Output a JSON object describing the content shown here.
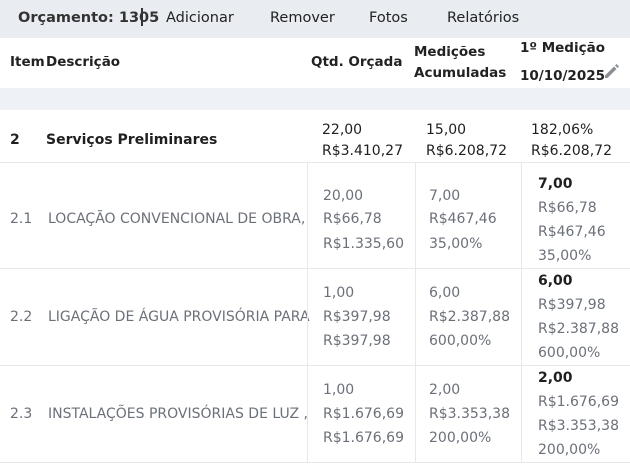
{
  "toolbar": {
    "budget_label": "Orçamento: 1305",
    "add_label": "Adicionar",
    "remove_label": "Remover",
    "photos_label": "Fotos",
    "reports_label": "Relatórios"
  },
  "table": {
    "headers": {
      "item": "Item",
      "description": "Descrição",
      "qty_budgeted": "Qtd. Orçada",
      "accumulated_line1": "Medições",
      "accumulated_line2": "Acumuladas",
      "first_measure_line1": "1º Medição",
      "first_measure_date": "10/10/2025"
    },
    "group": {
      "item": "2",
      "description": "Serviços Preliminares",
      "qty": [
        "22,00",
        "R$3.410,27"
      ],
      "accumulated": [
        "15,00",
        "R$6.208,72"
      ],
      "measure": [
        "182,06%",
        "R$6.208,72"
      ]
    },
    "rows": [
      {
        "item": "2.1",
        "description": "LOCAÇÃO CONVENCIONAL DE OBRA, U",
        "qty": [
          "20,00",
          "R$66,78",
          "R$1.335,60"
        ],
        "accumulated": [
          "7,00",
          "R$467,46",
          "35,00%"
        ],
        "measure": [
          "7,00",
          "R$66,78",
          "R$467,46",
          "35,00%"
        ]
      },
      {
        "item": "2.2",
        "description": "LIGAÇÃO DE ÁGUA PROVISÓRIA PARA",
        "qty": [
          "1,00",
          "R$397,98",
          "R$397,98"
        ],
        "accumulated": [
          "6,00",
          "R$2.387,88",
          "600,00%"
        ],
        "measure": [
          "6,00",
          "R$397,98",
          "R$2.387,88",
          "600,00%"
        ]
      },
      {
        "item": "2.3",
        "description": "INSTALAÇÕES PROVISÓRIAS DE LUZ , I",
        "qty": [
          "1,00",
          "R$1.676,69",
          "R$1.676,69"
        ],
        "accumulated": [
          "2,00",
          "R$3.353,38",
          "200,00%"
        ],
        "measure": [
          "2,00",
          "R$1.676,69",
          "R$3.353,38",
          "200,00%"
        ]
      }
    ]
  },
  "icons": {
    "edit": "pencil-icon"
  }
}
